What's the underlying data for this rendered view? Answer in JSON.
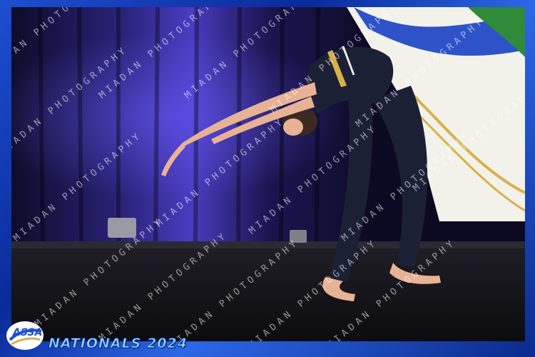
{
  "branding": {
    "logo_text": "ASSA",
    "event_title": "NATIONALS 2024"
  },
  "watermark": {
    "text": "MIADAN PHOTOGRAPHY"
  },
  "colors": {
    "frame_blue": "#1d4fd1",
    "frame_dark": "#0b2a8c",
    "curtain": "#1a1550",
    "stage_floor": "#141316",
    "leotard": "#1c2035",
    "skin": "#e8b294",
    "banner_bg": "#f3f2ea",
    "banner_gold": "#d8b04a"
  },
  "icons": {
    "logo": "assa-swoosh-logo"
  }
}
